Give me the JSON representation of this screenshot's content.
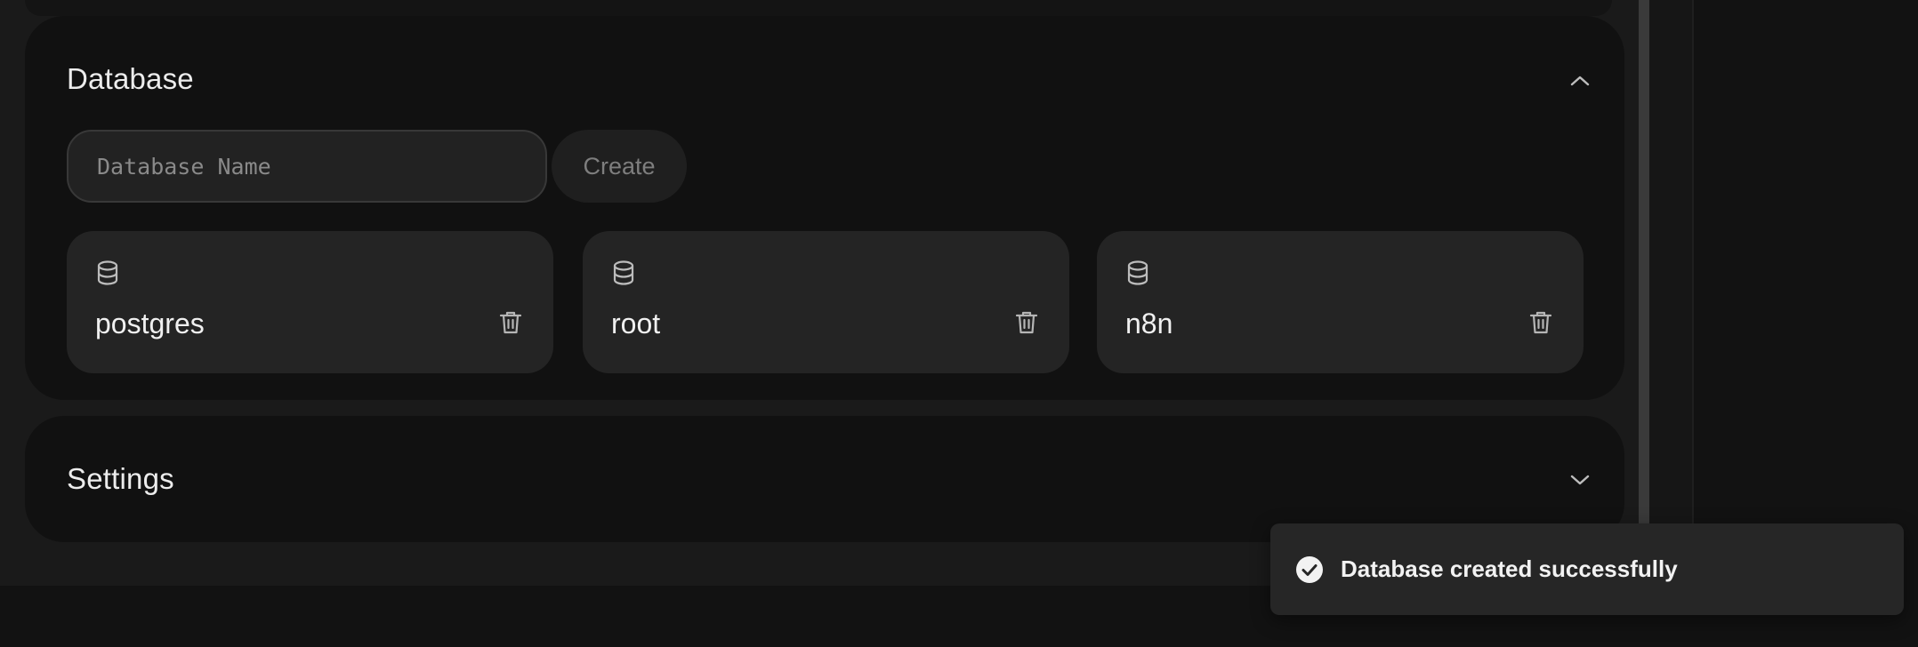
{
  "database_panel": {
    "title": "Database",
    "input_placeholder": "Database Name",
    "input_value": "",
    "create_label": "Create",
    "expanded": true,
    "databases": [
      {
        "name": "postgres",
        "icon": "database-icon",
        "action_icon": "trash-icon"
      },
      {
        "name": "root",
        "icon": "database-icon",
        "action_icon": "trash-icon"
      },
      {
        "name": "n8n",
        "icon": "database-icon",
        "action_icon": "trash-icon"
      }
    ]
  },
  "settings_panel": {
    "title": "Settings",
    "expanded": false
  },
  "toast": {
    "message": "Database created successfully",
    "icon": "check-circle-icon"
  },
  "colors": {
    "background": "#121212",
    "card": "#111111",
    "item": "#242424",
    "toast": "#262626",
    "text": "#ececec"
  }
}
